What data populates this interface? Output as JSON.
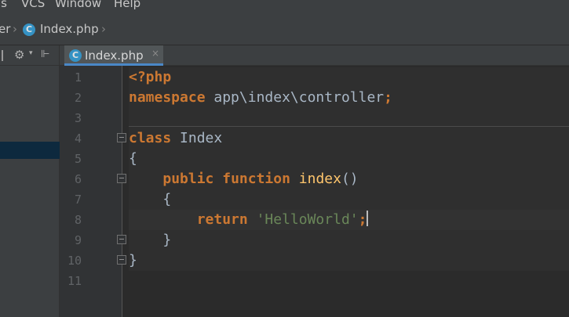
{
  "menu": {
    "items": [
      "ls",
      "VCS",
      "Window",
      "Help"
    ]
  },
  "breadcrumb": {
    "parent": "er",
    "file_icon": "C",
    "file": "Index.php"
  },
  "project_toolbar": {
    "gear_icon": "⚙",
    "dropdown_icon": "▾",
    "split_icon": "⊩"
  },
  "tabs": [
    {
      "icon": "C",
      "label": "Index.php",
      "close": "×"
    }
  ],
  "editor": {
    "line_numbers": [
      "1",
      "2",
      "3",
      "4",
      "5",
      "6",
      "7",
      "8",
      "9",
      "10",
      "11"
    ],
    "lines": [
      {
        "tokens": [
          {
            "t": "phptag",
            "v": "<?php"
          }
        ]
      },
      {
        "tokens": [
          {
            "t": "kw",
            "v": "namespace"
          },
          {
            "t": "plain",
            "v": " app\\index\\controller"
          },
          {
            "t": "kw",
            "v": ";"
          }
        ]
      },
      {
        "tokens": []
      },
      {
        "tokens": [
          {
            "t": "kw",
            "v": "class"
          },
          {
            "t": "plain",
            "v": " Index"
          }
        ]
      },
      {
        "tokens": [
          {
            "t": "plain",
            "v": "{"
          }
        ]
      },
      {
        "tokens": [
          {
            "t": "plain",
            "v": "    "
          },
          {
            "t": "kw",
            "v": "public"
          },
          {
            "t": "plain",
            "v": " "
          },
          {
            "t": "kw",
            "v": "function"
          },
          {
            "t": "plain",
            "v": " "
          },
          {
            "t": "fn",
            "v": "index"
          },
          {
            "t": "plain",
            "v": "()"
          }
        ]
      },
      {
        "tokens": [
          {
            "t": "plain",
            "v": "    {"
          }
        ]
      },
      {
        "tokens": [
          {
            "t": "plain",
            "v": "        "
          },
          {
            "t": "kw",
            "v": "return"
          },
          {
            "t": "plain",
            "v": " "
          },
          {
            "t": "str",
            "v": "'HelloWorld'"
          },
          {
            "t": "kw",
            "v": ";"
          }
        ],
        "current": true
      },
      {
        "tokens": [
          {
            "t": "plain",
            "v": "    }"
          }
        ]
      },
      {
        "tokens": [
          {
            "t": "plain",
            "v": "}"
          }
        ]
      },
      {
        "tokens": []
      }
    ]
  },
  "colors": {
    "keyword": "#cc7832",
    "string": "#6a8759",
    "text": "#a9b7c6",
    "tab_accent": "#4a88c7",
    "class_icon": "#3592c4"
  }
}
